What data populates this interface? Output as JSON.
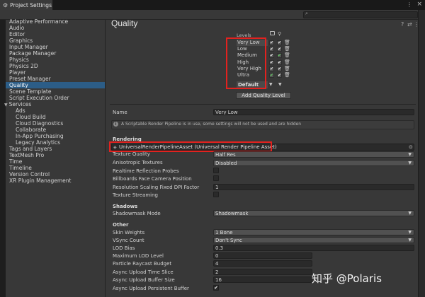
{
  "window": {
    "tab_title": "Project Settings",
    "tab_icon": "⚙",
    "menu_icon": "⋮",
    "close_icon": "×"
  },
  "search": {
    "placeholder": ""
  },
  "sidebar": {
    "items": [
      {
        "label": "Adaptive Performance"
      },
      {
        "label": "Audio"
      },
      {
        "label": "Editor"
      },
      {
        "label": "Graphics"
      },
      {
        "label": "Input Manager"
      },
      {
        "label": "Package Manager"
      },
      {
        "label": "Physics"
      },
      {
        "label": "Physics 2D"
      },
      {
        "label": "Player"
      },
      {
        "label": "Preset Manager"
      },
      {
        "label": "Quality"
      },
      {
        "label": "Scene Template"
      },
      {
        "label": "Script Execution Order"
      },
      {
        "label": "Services"
      },
      {
        "label": "Ads"
      },
      {
        "label": "Cloud Build"
      },
      {
        "label": "Cloud Diagnostics"
      },
      {
        "label": "Collaborate"
      },
      {
        "label": "In-App Purchasing"
      },
      {
        "label": "Legacy Analytics"
      },
      {
        "label": "Tags and Layers"
      },
      {
        "label": "TextMesh Pro"
      },
      {
        "label": "Time"
      },
      {
        "label": "Timeline"
      },
      {
        "label": "Version Control"
      },
      {
        "label": "XR Plugin Management"
      }
    ],
    "selected": "Quality",
    "services_arrow": "▼"
  },
  "main": {
    "title": "Quality",
    "header_icons": [
      "?",
      "⇄",
      "⋮"
    ],
    "levels_label": "Levels",
    "levels": [
      {
        "name": "Very Low"
      },
      {
        "name": "Low"
      },
      {
        "name": "Medium"
      },
      {
        "name": "High"
      },
      {
        "name": "Very High"
      },
      {
        "name": "Ultra"
      }
    ],
    "default_label": "Default",
    "add_level_button": "Add Quality Level",
    "name_label": "Name",
    "name_value": "Very Low",
    "info_text": "A Scriptable Render Pipeline is in use, some settings will not be used and are hidden",
    "rendering_header": "Rendering",
    "pipeline_asset": "UniversalRenderPipelineAsset (Universal Render Pipeline Asset)",
    "rows": [
      {
        "label": "Texture Quality",
        "value": "Half Res"
      },
      {
        "label": "Anisotropic Textures",
        "value": "Disabled"
      },
      {
        "label": "Realtime Reflection Probes"
      },
      {
        "label": "Billboards Face Camera Position"
      },
      {
        "label": "Resolution Scaling Fixed DPI Factor",
        "value": "1"
      },
      {
        "label": "Texture Streaming"
      }
    ],
    "shadows_header": "Shadows",
    "shadowmask_label": "Shadowmask Mode",
    "shadowmask_value": "Shadowmask",
    "other_header": "Other",
    "other_rows": [
      {
        "label": "Skin Weights",
        "value": "1 Bone"
      },
      {
        "label": "VSync Count",
        "value": "Don't Sync"
      },
      {
        "label": "LOD Bias",
        "value": "0.3"
      },
      {
        "label": "Maximum LOD Level",
        "value": "0"
      },
      {
        "label": "Particle Raycast Budget",
        "value": "4"
      },
      {
        "label": "Async Upload Time Slice",
        "value": "2"
      },
      {
        "label": "Async Upload Buffer Size",
        "value": "16"
      },
      {
        "label": "Async Upload Persistent Buffer",
        "value": "✔"
      }
    ]
  },
  "watermark": "知乎 @Polaris",
  "colors": {
    "selection": "#2c5d87",
    "highlight_red": "#e2221f",
    "panel": "#383838"
  }
}
